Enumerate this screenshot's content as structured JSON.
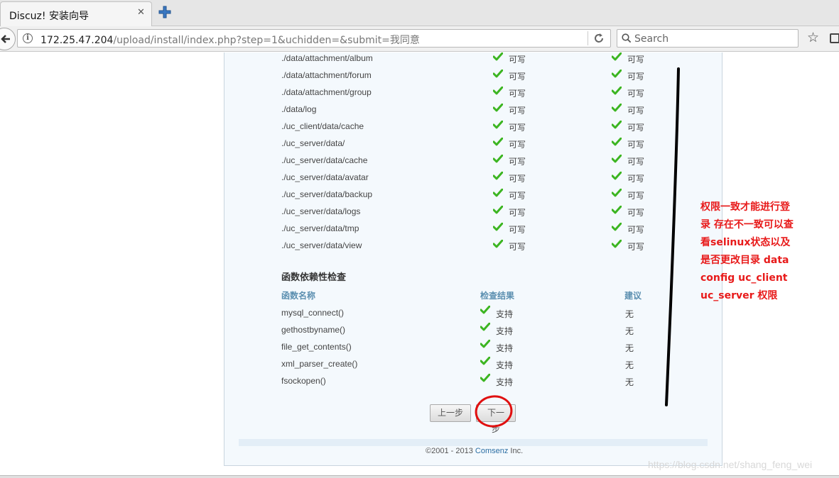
{
  "browser": {
    "tab_title": "Discuz! 安装向导",
    "url_host": "172.25.47.204",
    "url_rest": "/upload/install/index.php?step=1&uchidden=&submit=我同意",
    "search_placeholder": "Search"
  },
  "dir_rows": [
    {
      "path": "./data/attachment/album",
      "current": "可写",
      "required": "可写"
    },
    {
      "path": "./data/attachment/forum",
      "current": "可写",
      "required": "可写"
    },
    {
      "path": "./data/attachment/group",
      "current": "可写",
      "required": "可写"
    },
    {
      "path": "./data/log",
      "current": "可写",
      "required": "可写"
    },
    {
      "path": "./uc_client/data/cache",
      "current": "可写",
      "required": "可写"
    },
    {
      "path": "./uc_server/data/",
      "current": "可写",
      "required": "可写"
    },
    {
      "path": "./uc_server/data/cache",
      "current": "可写",
      "required": "可写"
    },
    {
      "path": "./uc_server/data/avatar",
      "current": "可写",
      "required": "可写"
    },
    {
      "path": "./uc_server/data/backup",
      "current": "可写",
      "required": "可写"
    },
    {
      "path": "./uc_server/data/logs",
      "current": "可写",
      "required": "可写"
    },
    {
      "path": "./uc_server/data/tmp",
      "current": "可写",
      "required": "可写"
    },
    {
      "path": "./uc_server/data/view",
      "current": "可写",
      "required": "可写"
    }
  ],
  "func_section": {
    "title": "函数依赖性检查",
    "col_name": "函数名称",
    "col_result": "检查结果",
    "col_suggest": "建议",
    "rows": [
      {
        "name": "mysql_connect()",
        "result": "支持",
        "suggest": "无"
      },
      {
        "name": "gethostbyname()",
        "result": "支持",
        "suggest": "无"
      },
      {
        "name": "file_get_contents()",
        "result": "支持",
        "suggest": "无"
      },
      {
        "name": "xml_parser_create()",
        "result": "支持",
        "suggest": "无"
      },
      {
        "name": "fsockopen()",
        "result": "支持",
        "suggest": "无"
      }
    ]
  },
  "buttons": {
    "prev": "上一步",
    "next": "下一步"
  },
  "footer": {
    "copy_prefix": "©2001 - 2013 ",
    "company": "Comsenz",
    "copy_suffix": " Inc."
  },
  "annotation": {
    "lines": [
      "权限一致才能进行登",
      "录 存在不一致可以查",
      "看selinux状态以及",
      "是否更改目录  data",
      "config  uc_client",
      "uc_server 权限"
    ],
    "color": "#e81a1a"
  },
  "watermark": "https://blog.csdn.net/shang_feng_wei",
  "colors": {
    "check_green": "#3cb521",
    "header_blue": "#5b8fb0",
    "circle_red": "#e01010"
  }
}
